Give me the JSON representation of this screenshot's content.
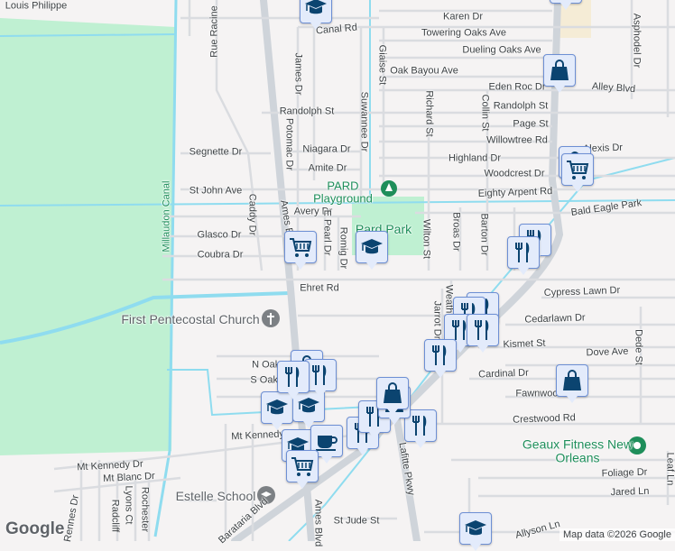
{
  "map": {
    "labels": [
      "Louis Philippe",
      "Rue Racine",
      "Canal Rd",
      "Karen Dr",
      "Towering Oaks Ave",
      "Dueling Oaks Ave",
      "Oak Bayou Ave",
      "Eden Roc Dr",
      "Alley Blvd",
      "Randolph St",
      "Randolph St",
      "Page St",
      "Willowtree Rd",
      "Alexis Dr",
      "Highland Dr",
      "Woodcrest Dr",
      "Eighty Arpent Rd",
      "Bald Eagle Park",
      "James Dr",
      "Potomac Dr",
      "Suwannee Dr",
      "Giaise St",
      "Richard St",
      "Collin St",
      "Segnette Dr",
      "Niagara Dr",
      "Amite Dr",
      "St John Ave",
      "Caddy Dr",
      "Avery Dr",
      "E Pearl Dr",
      "Romig Dr",
      "Glasco Dr",
      "Coubra Dr",
      "Wilton St",
      "Broas Dr",
      "Barton Dr",
      "Asphodel Dr",
      "Ehret Rd",
      "Cypress Lawn Dr",
      "Cedarlawn Dr",
      "Kismet St",
      "Dove Ave",
      "Dede St",
      "Cardinal Dr",
      "Fawnwood",
      "Crestwood Rd",
      "Jarrot Dr",
      "Weathersby",
      "N Oak Dr",
      "S Oak Dr",
      "Mt Kennedy Dr",
      "Mt Kennedy Dr",
      "Mt Blanc Dr",
      "Barataria Blvd",
      "Lafitte Pkwy",
      "Ames Blvd",
      "St Jude St",
      "Allyson Ln",
      "Foliage Dr",
      "Jared Ln",
      "Leaf Ln",
      "Rennes Dr",
      "Lyons Ct",
      "Rochester",
      "Radcliff",
      "Millaudon Canal",
      "Ames Blvd"
    ],
    "places": {
      "pard_playground": "PARD Playground",
      "pard_park": "Pard Park",
      "church": "First Pentecostal Church",
      "school": "Estelle School",
      "fitness": "Geaux Fitness New Orleans"
    },
    "attribution": "Map data ©2026 Google",
    "logo": "Google"
  },
  "markers": [
    "school",
    "bag",
    "bag",
    "bag",
    "cart",
    "food",
    "food",
    "school",
    "cart",
    "food",
    "food",
    "food",
    "food",
    "food",
    "bag",
    "food",
    "food",
    "food",
    "bag",
    "bag",
    "school",
    "school",
    "bag",
    "food",
    "food",
    "school",
    "coffee",
    "cart",
    "school"
  ],
  "colors": {
    "park": "#bff0d2",
    "canal": "#8fdcef",
    "road": "#dadce0",
    "marker_bg": "#e3ebfb",
    "marker_icon": "#0b4470",
    "poi_green": "#1e8e5a"
  }
}
